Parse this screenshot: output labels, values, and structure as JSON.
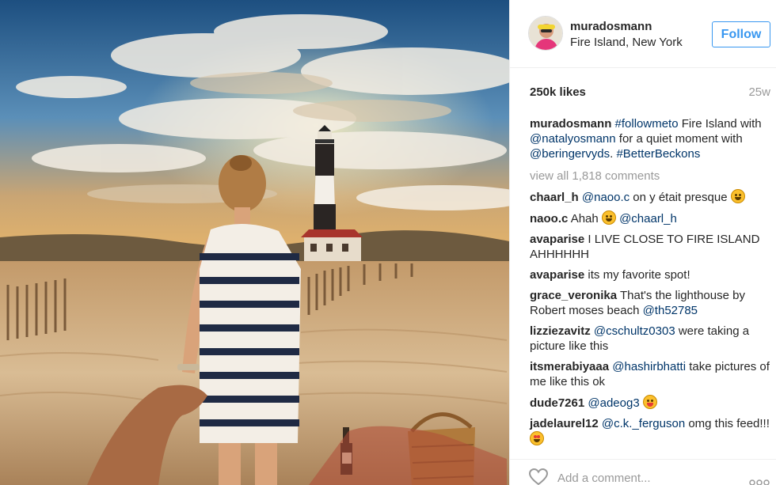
{
  "post": {
    "username": "muradosmann",
    "location": "Fire Island, New York",
    "follow_label": "Follow",
    "likes": "250k likes",
    "age": "25w",
    "caption": {
      "user": "muradosmann",
      "parts": [
        "#followmeto",
        " Fire Island with ",
        "@natalyosmann",
        " for a quiet moment with ",
        "@beringervyds",
        ". ",
        "#BetterBeckons"
      ]
    },
    "view_all": "view all 1,818 comments",
    "add_comment_placeholder": "Add a comment..."
  },
  "comments": [
    {
      "user": "chaarl_h",
      "mention": "@naoo.c",
      "text": " on y était presque ",
      "emoji": "laughing-face"
    },
    {
      "user": "naoo.c",
      "text_pre": "Ahah ",
      "emoji": "grinning-face",
      "mention": "@chaarl_h"
    },
    {
      "user": "avaparise",
      "text": "I LIVE CLOSE TO FIRE ISLAND AHHHHHH"
    },
    {
      "user": "avaparise",
      "text": "its my favorite spot!"
    },
    {
      "user": "grace_veronika",
      "text": "That's the lighthouse by Robert moses beach ",
      "mention": "@th52785"
    },
    {
      "user": "lizziezavitz",
      "mention": "@cschultz0303",
      "text": " were taking a picture like this"
    },
    {
      "user": "itsmerabiyaaa",
      "mention": "@hashirbhatti",
      "text": " take pictures of me like this ok"
    },
    {
      "user": "dude7261",
      "mention": "@adeog3",
      "emoji": "winking-tongue-face"
    },
    {
      "user": "jadelaurel12",
      "mention": "@c.k._ferguson",
      "text": " omg this feed!!! ",
      "emoji": "heart-eyes-face"
    }
  ],
  "colors": {
    "link": "#003569",
    "follow": "#3897f0",
    "muted": "#999999",
    "text": "#262626"
  },
  "icons": {
    "like": "heart-outline-icon",
    "more": "more-dots-icon"
  }
}
